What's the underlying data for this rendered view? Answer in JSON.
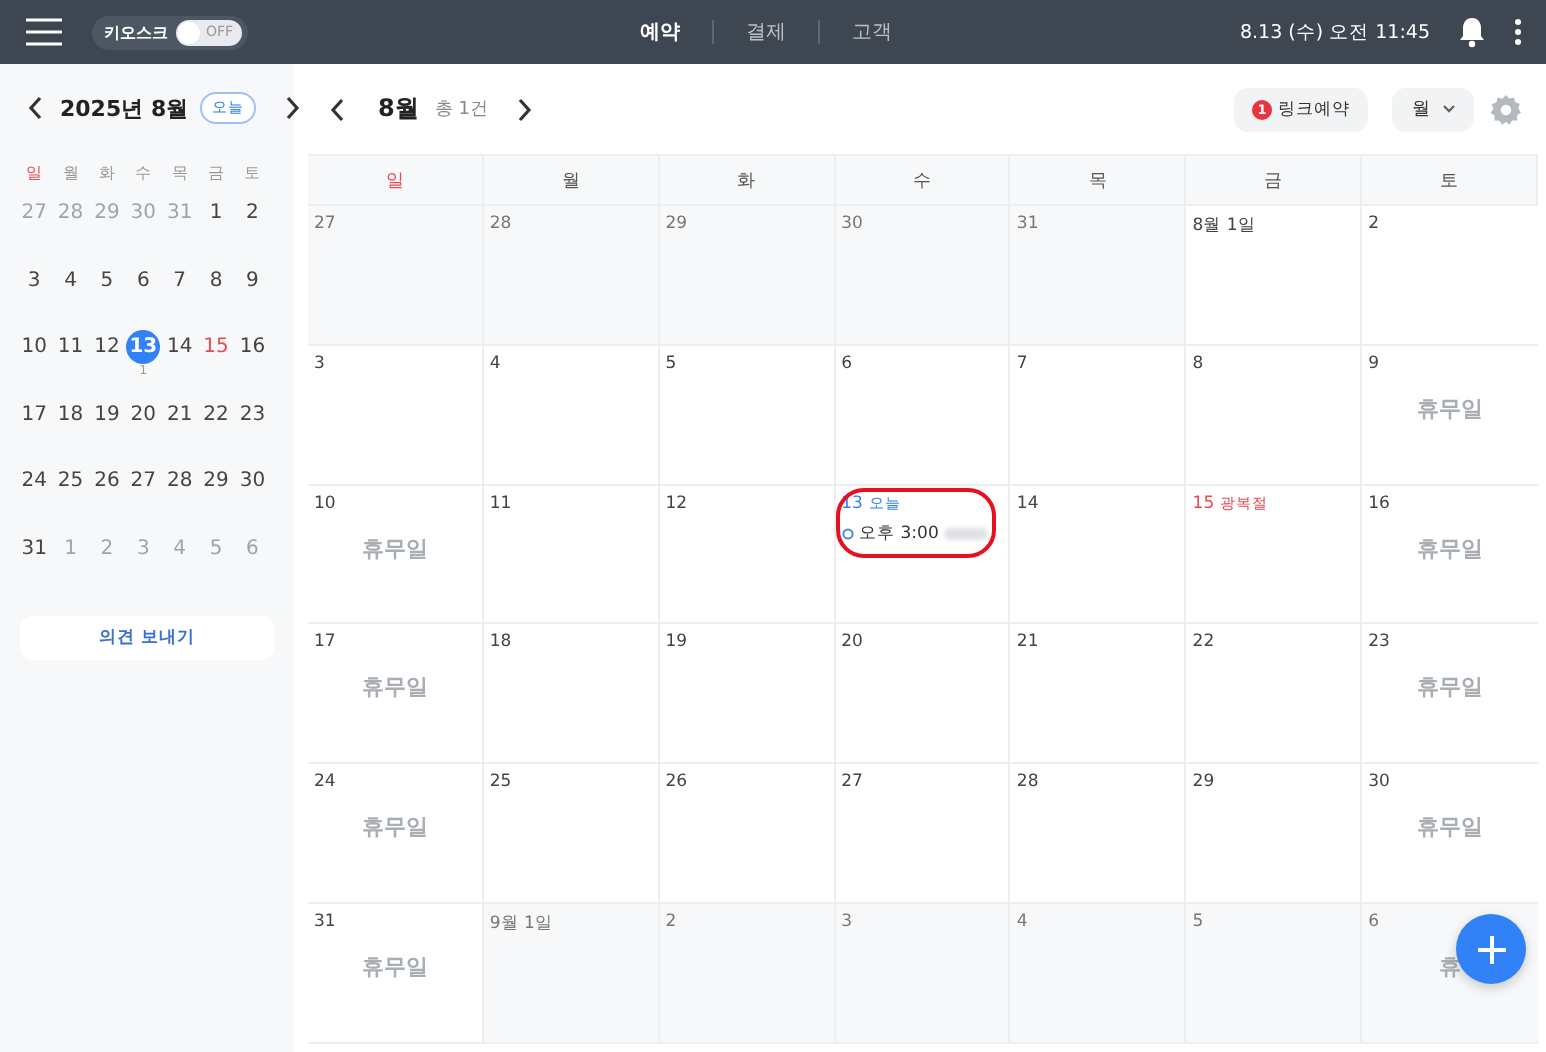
{
  "topbar": {
    "kiosk_label": "키오스크",
    "kiosk_switch": {
      "on": false,
      "label": "OFF"
    },
    "tabs": [
      {
        "label": "예약",
        "selected": true
      },
      {
        "label": "결제",
        "selected": false
      },
      {
        "label": "고객",
        "selected": false
      }
    ],
    "datetime": "8.13 (수) 오전 11:45"
  },
  "mini_calendar": {
    "title": "2025년 8월",
    "today_button": "오늘",
    "weekdays": [
      {
        "label": "일",
        "kind": "sunday"
      },
      {
        "label": "월",
        "kind": "weekday"
      },
      {
        "label": "화",
        "kind": "weekday"
      },
      {
        "label": "수",
        "kind": "weekday"
      },
      {
        "label": "목",
        "kind": "weekday"
      },
      {
        "label": "금",
        "kind": "weekday"
      },
      {
        "label": "토",
        "kind": "weekday"
      }
    ],
    "weeks": [
      [
        {
          "day": "27",
          "kind": "other"
        },
        {
          "day": "28",
          "kind": "other"
        },
        {
          "day": "29",
          "kind": "other"
        },
        {
          "day": "30",
          "kind": "other"
        },
        {
          "day": "31",
          "kind": "other"
        },
        {
          "day": "1",
          "kind": "normal"
        },
        {
          "day": "2",
          "kind": "normal"
        }
      ],
      [
        {
          "day": "3",
          "kind": "normal"
        },
        {
          "day": "4",
          "kind": "normal"
        },
        {
          "day": "5",
          "kind": "normal"
        },
        {
          "day": "6",
          "kind": "normal"
        },
        {
          "day": "7",
          "kind": "normal"
        },
        {
          "day": "8",
          "kind": "normal"
        },
        {
          "day": "9",
          "kind": "normal"
        }
      ],
      [
        {
          "day": "10",
          "kind": "normal"
        },
        {
          "day": "11",
          "kind": "normal"
        },
        {
          "day": "12",
          "kind": "normal"
        },
        {
          "day": "13",
          "kind": "today",
          "count": "1"
        },
        {
          "day": "14",
          "kind": "normal"
        },
        {
          "day": "15",
          "kind": "holiday"
        },
        {
          "day": "16",
          "kind": "normal"
        }
      ],
      [
        {
          "day": "17",
          "kind": "normal"
        },
        {
          "day": "18",
          "kind": "normal"
        },
        {
          "day": "19",
          "kind": "normal"
        },
        {
          "day": "20",
          "kind": "normal"
        },
        {
          "day": "21",
          "kind": "normal"
        },
        {
          "day": "22",
          "kind": "normal"
        },
        {
          "day": "23",
          "kind": "normal"
        }
      ],
      [
        {
          "day": "24",
          "kind": "normal"
        },
        {
          "day": "25",
          "kind": "normal"
        },
        {
          "day": "26",
          "kind": "normal"
        },
        {
          "day": "27",
          "kind": "normal"
        },
        {
          "day": "28",
          "kind": "normal"
        },
        {
          "day": "29",
          "kind": "normal"
        },
        {
          "day": "30",
          "kind": "normal"
        }
      ],
      [
        {
          "day": "31",
          "kind": "normal"
        },
        {
          "day": "1",
          "kind": "other"
        },
        {
          "day": "2",
          "kind": "other"
        },
        {
          "day": "3",
          "kind": "other"
        },
        {
          "day": "4",
          "kind": "other"
        },
        {
          "day": "5",
          "kind": "other"
        },
        {
          "day": "6",
          "kind": "other"
        }
      ]
    ],
    "feedback_button": "의견 보내기"
  },
  "toolbar": {
    "month": "8월",
    "count": "총 1건",
    "link_badge": "1",
    "link_button": "링크예약",
    "view_select": "월"
  },
  "calendar": {
    "weekdays": [
      {
        "label": "일",
        "kind": "sunday"
      },
      {
        "label": "월",
        "kind": "weekday"
      },
      {
        "label": "화",
        "kind": "weekday"
      },
      {
        "label": "수",
        "kind": "weekday"
      },
      {
        "label": "목",
        "kind": "weekday"
      },
      {
        "label": "금",
        "kind": "weekday"
      },
      {
        "label": "토",
        "kind": "weekday"
      }
    ],
    "weeks": [
      [
        {
          "date": "27",
          "other": true
        },
        {
          "date": "28",
          "other": true
        },
        {
          "date": "29",
          "other": true
        },
        {
          "date": "30",
          "other": true
        },
        {
          "date": "31",
          "other": true
        },
        {
          "date": "8월 1일",
          "other": false
        },
        {
          "date": "2",
          "other": false
        }
      ],
      [
        {
          "date": "3",
          "other": false
        },
        {
          "date": "4",
          "other": false
        },
        {
          "date": "5",
          "other": false
        },
        {
          "date": "6",
          "other": false
        },
        {
          "date": "7",
          "other": false
        },
        {
          "date": "8",
          "other": false
        },
        {
          "date": "9",
          "other": false,
          "closed": "휴무일"
        }
      ],
      [
        {
          "date": "10",
          "other": false,
          "closed": "휴무일"
        },
        {
          "date": "11",
          "other": false
        },
        {
          "date": "12",
          "other": false
        },
        {
          "date": "13",
          "other": false,
          "today": "오늘",
          "highlighted": true,
          "events": [
            {
              "time": "오후 3:00"
            }
          ]
        },
        {
          "date": "14",
          "other": false
        },
        {
          "date": "15",
          "other": false,
          "holiday": "광복절"
        },
        {
          "date": "16",
          "other": false,
          "closed": "휴무일"
        }
      ],
      [
        {
          "date": "17",
          "other": false,
          "closed": "휴무일"
        },
        {
          "date": "18",
          "other": false
        },
        {
          "date": "19",
          "other": false
        },
        {
          "date": "20",
          "other": false
        },
        {
          "date": "21",
          "other": false
        },
        {
          "date": "22",
          "other": false
        },
        {
          "date": "23",
          "other": false,
          "closed": "휴무일"
        }
      ],
      [
        {
          "date": "24",
          "other": false,
          "closed": "휴무일"
        },
        {
          "date": "25",
          "other": false
        },
        {
          "date": "26",
          "other": false
        },
        {
          "date": "27",
          "other": false
        },
        {
          "date": "28",
          "other": false
        },
        {
          "date": "29",
          "other": false
        },
        {
          "date": "30",
          "other": false,
          "closed": "휴무일"
        }
      ],
      [
        {
          "date": "31",
          "other": false,
          "closed": "휴무일"
        },
        {
          "date": "9월 1일",
          "other": true
        },
        {
          "date": "2",
          "other": true
        },
        {
          "date": "3",
          "other": true
        },
        {
          "date": "4",
          "other": true
        },
        {
          "date": "5",
          "other": true
        },
        {
          "date": "6",
          "other": true,
          "closed": "휴"
        }
      ]
    ]
  }
}
